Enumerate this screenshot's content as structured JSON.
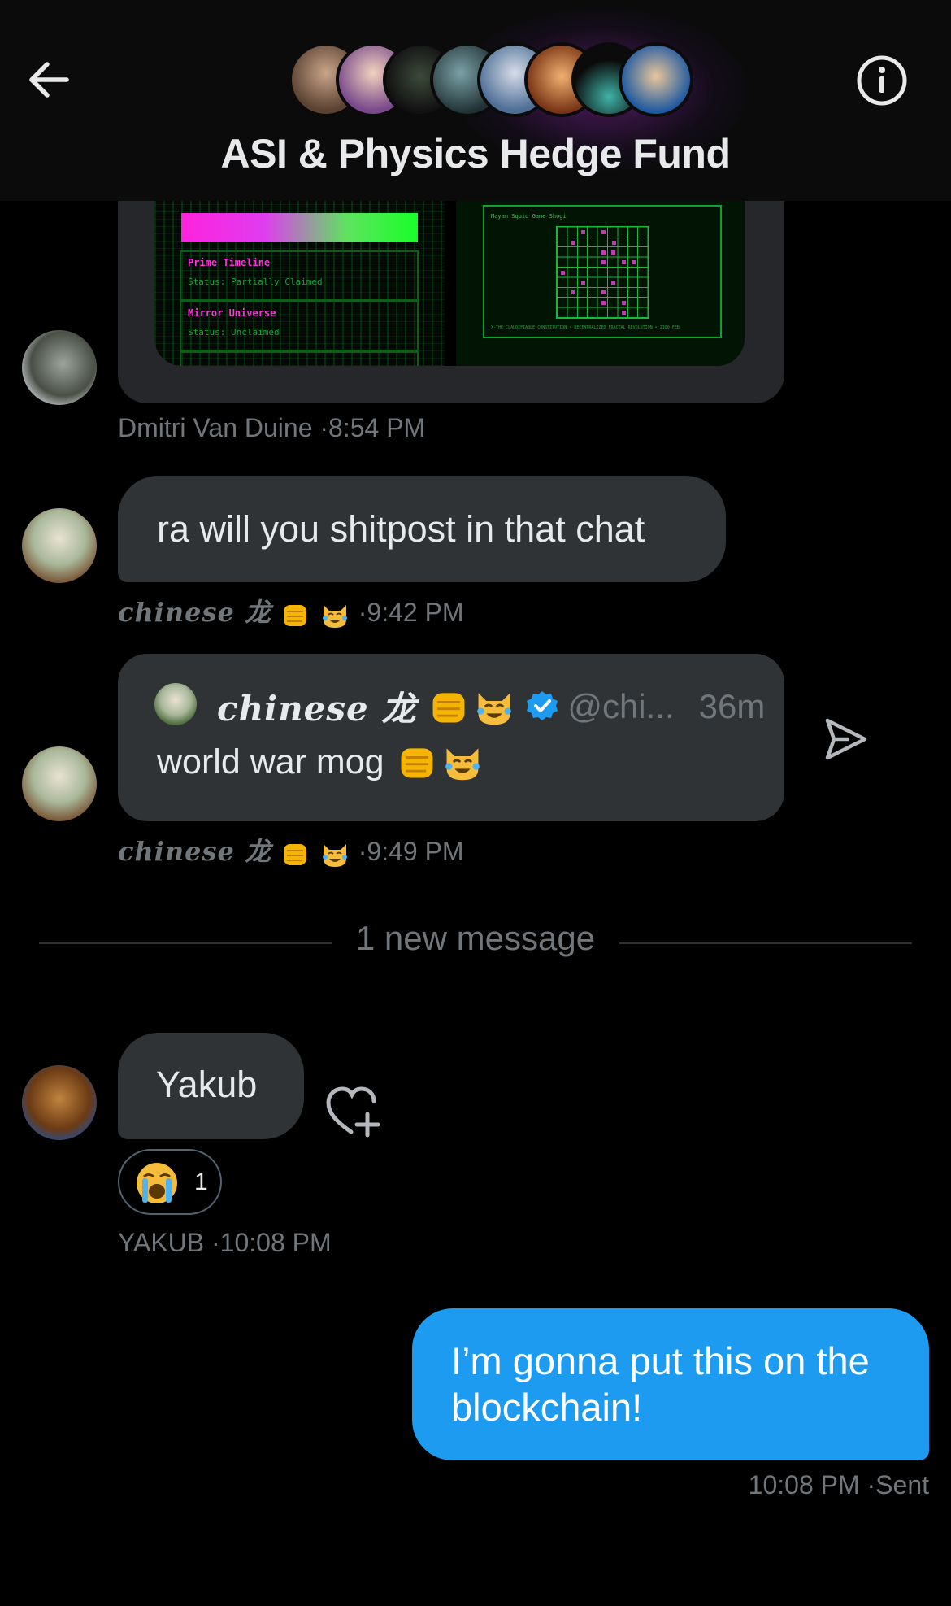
{
  "header": {
    "title": "ASI  & Physics Hedge Fund",
    "back_icon": "arrow-left-icon",
    "info_icon": "info-circle-icon",
    "member_avatar_colors": [
      "#7a5a45",
      "#d8b39a",
      "#2b3a2a",
      "#3f5a62",
      "#7f97b5",
      "#c6662e",
      "#1b1b1b",
      "#3066a6"
    ]
  },
  "media_message": {
    "left_image": {
      "rows": [
        {
          "title": "Prime Timeline",
          "status": "Status: Partially Claimed"
        },
        {
          "title": "Mirror Universe",
          "status": "Status: Unclaimed"
        }
      ]
    },
    "right_image": {
      "caption": "Mayan Squid Game Shogi",
      "footer": "X-THE CLAUDIFIABLE CONSTITUTION • DECENTRALIZED FRACTAL REVOLUTION • 2100 FEB"
    },
    "author": "Dmitri Van Duine",
    "time": "8:54 PM"
  },
  "message_ra": {
    "text": "ra will you shitpost in that chat",
    "author": "chinese 龙",
    "time": "9:42 PM"
  },
  "quoted_post": {
    "display_name": "chinese 龙",
    "handle": "@chi...",
    "age": "36m",
    "text": "world war mog",
    "verified_color": "#1d9bf0",
    "author": "chinese 龙",
    "time": "9:49 PM",
    "share_icon": "send-icon"
  },
  "new_message_divider": "1 new message",
  "message_yakub": {
    "text": "Yakub",
    "reaction_emoji": "loudly-crying-face",
    "reaction_count": "1",
    "author": "YAKUB",
    "time": "10:08 PM",
    "add_reaction_icon": "heart-plus-icon"
  },
  "message_sent": {
    "text": "I’m gonna put this on the blockchain!",
    "time": "10:08 PM",
    "status": "Sent",
    "bubble_color": "#1d9bf0"
  },
  "separator": "·"
}
